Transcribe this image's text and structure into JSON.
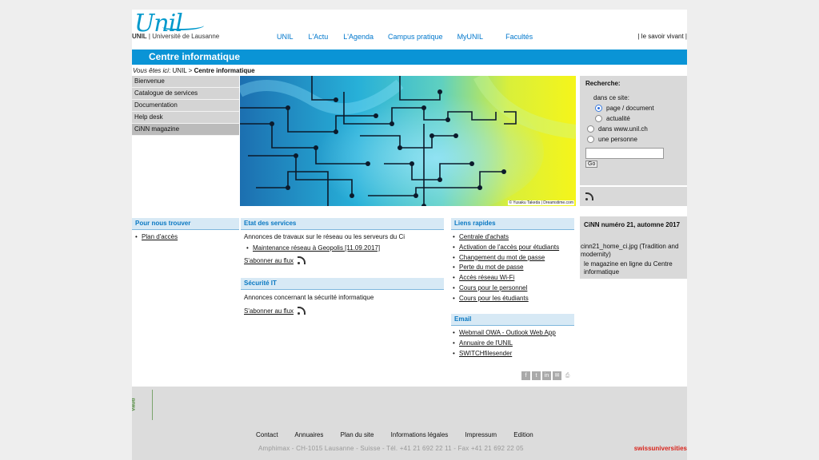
{
  "header": {
    "logo_mark": "Unil",
    "logo_short": "UNIL",
    "logo_text": "Université de Lausanne",
    "nav": [
      "UNIL",
      "L'Actu",
      "L'Agenda",
      "Campus pratique",
      "MyUNIL",
      "Facultés"
    ],
    "tagline": "| le savoir vivant |",
    "section_title": "Centre informatique"
  },
  "breadcrumb": {
    "prefix": "Vous êtes ici",
    "sep1": ": ",
    "home": "UNIL",
    "sep2": " > ",
    "current": "Centre informatique"
  },
  "sidebar": {
    "items": [
      "Bienvenue",
      "Catalogue de services",
      "Documentation",
      "Help desk",
      "CiNN magazine"
    ],
    "active_index": 4
  },
  "hero": {
    "credit": "© Yusaku Takeda | Dreamstime.com"
  },
  "search": {
    "title": "Recherche:",
    "scope_label": "dans ce site:",
    "options": [
      "page / document",
      "actualité",
      "dans www.unil.ch",
      "une personne"
    ],
    "selected": "page / document",
    "query": "",
    "go_label": "Go"
  },
  "boxes": {
    "trouver": {
      "title": "Pour nous trouver",
      "links": [
        "Plan d'accès"
      ]
    },
    "etat": {
      "title": "Etat des services",
      "text": "Annonces de travaux sur le réseau ou les serveurs du Ci",
      "links": [
        "Maintenance réseau à Geopolis [11.09.2017]"
      ],
      "subscribe": "S'abonner au flux"
    },
    "securite": {
      "title": "Sécurité IT",
      "text": "Annonces concernant la sécurité informatique",
      "subscribe": "S'abonner au flux"
    },
    "liens": {
      "title": "Liens rapides",
      "links": [
        "Centrale d'achats",
        "Activation de l'accès pour étudiants",
        "Changement du mot de passe",
        "Perte du mot de passe",
        "Accès réseau Wi-Fi",
        "Cours pour le personnel",
        "Cours pour les étudiants"
      ]
    },
    "email": {
      "title": "Email",
      "links": [
        "Webmail OWA - Outlook Web App",
        "Annuaire de l'UNIL",
        "SWITCHfilesender"
      ]
    }
  },
  "cinn": {
    "title": "CiNN numéro 21, automne 2017",
    "image_alt": "cinn21_home_ci.jpg (Tradition and modernity)",
    "desc": "le magazine en ligne du Centre informatique"
  },
  "share_icons": [
    "facebook-icon",
    "twitter-icon",
    "linkedin-icon",
    "email-icon",
    "print-icon"
  ],
  "share_glyphs": [
    "f",
    "t",
    "in",
    "✉",
    "⎙"
  ],
  "footer": {
    "vaud": "vaud",
    "links": [
      "Contact",
      "Annuaires",
      "Plan du site",
      "Informations légales",
      "Impressum",
      "Edition"
    ],
    "address": "Amphimax  -  CH-1015 Lausanne  -  Suisse  -  Tél. +41 21 692 22 11  -  Fax +41 21 692 22 05",
    "partner": "swissuniversities"
  },
  "colors": {
    "brand_blue": "#0a94d6",
    "link_blue": "#0077cc",
    "box_head": "#d7e9f5",
    "panel_grey": "#d9d9d9"
  }
}
